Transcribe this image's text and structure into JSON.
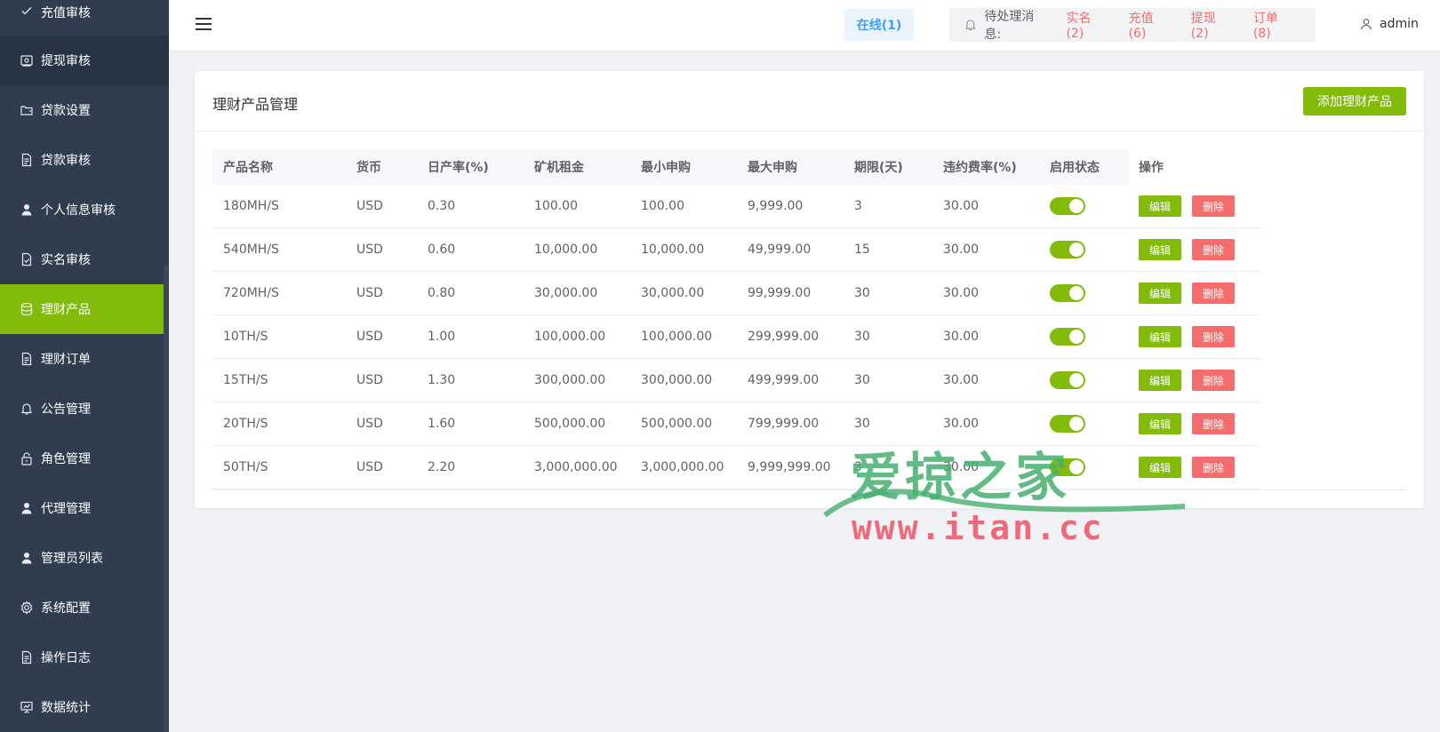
{
  "sidebar": {
    "items": [
      {
        "label": "充值审核",
        "icon": "check-icon"
      },
      {
        "label": "提现审核",
        "icon": "wallet-icon"
      },
      {
        "label": "贷款设置",
        "icon": "folder-icon"
      },
      {
        "label": "贷款审核",
        "icon": "document-icon"
      },
      {
        "label": "个人信息审核",
        "icon": "user-icon"
      },
      {
        "label": "实名审核",
        "icon": "document-check-icon"
      },
      {
        "label": "理财产品",
        "icon": "database-icon"
      },
      {
        "label": "理财订单",
        "icon": "document-icon"
      },
      {
        "label": "公告管理",
        "icon": "bell-icon"
      },
      {
        "label": "角色管理",
        "icon": "lock-icon"
      },
      {
        "label": "代理管理",
        "icon": "user-icon"
      },
      {
        "label": "管理员列表",
        "icon": "user-icon"
      },
      {
        "label": "系统配置",
        "icon": "gear-icon"
      },
      {
        "label": "操作日志",
        "icon": "document-icon"
      },
      {
        "label": "数据统计",
        "icon": "presentation-icon"
      }
    ],
    "active_index": 6,
    "colors": {
      "background": "#2f3d4f",
      "active": "#82bb0a"
    }
  },
  "header": {
    "online": "在线(1)",
    "pending_label": "待处理消息:",
    "pending_links": [
      "实名(2)",
      "充值(6)",
      "提现(2)",
      "订单(8)"
    ],
    "user": "admin"
  },
  "card": {
    "title": "理财产品管理",
    "add_button": "添加理财产品"
  },
  "table": {
    "columns": [
      "产品名称",
      "货币",
      "日产率(%)",
      "矿机租金",
      "最小申购",
      "最大申购",
      "期限(天)",
      "违约费率(%)",
      "启用状态",
      "操作"
    ],
    "rows": [
      {
        "name": "180MH/S",
        "currency": "USD",
        "daily_rate": "0.30",
        "rent": "100.00",
        "min": "100.00",
        "max": "9,999.00",
        "days": "3",
        "penalty": "30.00",
        "enabled": true
      },
      {
        "name": "540MH/S",
        "currency": "USD",
        "daily_rate": "0.60",
        "rent": "10,000.00",
        "min": "10,000.00",
        "max": "49,999.00",
        "days": "15",
        "penalty": "30.00",
        "enabled": true
      },
      {
        "name": "720MH/S",
        "currency": "USD",
        "daily_rate": "0.80",
        "rent": "30,000.00",
        "min": "30,000.00",
        "max": "99,999.00",
        "days": "30",
        "penalty": "30.00",
        "enabled": true
      },
      {
        "name": "10TH/S",
        "currency": "USD",
        "daily_rate": "1.00",
        "rent": "100,000.00",
        "min": "100,000.00",
        "max": "299,999.00",
        "days": "30",
        "penalty": "30.00",
        "enabled": true
      },
      {
        "name": "15TH/S",
        "currency": "USD",
        "daily_rate": "1.30",
        "rent": "300,000.00",
        "min": "300,000.00",
        "max": "499,999.00",
        "days": "30",
        "penalty": "30.00",
        "enabled": true
      },
      {
        "name": "20TH/S",
        "currency": "USD",
        "daily_rate": "1.60",
        "rent": "500,000.00",
        "min": "500,000.00",
        "max": "799,999.00",
        "days": "30",
        "penalty": "30.00",
        "enabled": true
      },
      {
        "name": "50TH/S",
        "currency": "USD",
        "daily_rate": "2.20",
        "rent": "3,000,000.00",
        "min": "3,000,000.00",
        "max": "9,999,999.00",
        "days": "3",
        "penalty": "30.00",
        "enabled": true
      }
    ],
    "edit_label": "编辑",
    "delete_label": "删除"
  },
  "watermark": {
    "text": "爱掠之家",
    "url": "www.itan.cc"
  }
}
